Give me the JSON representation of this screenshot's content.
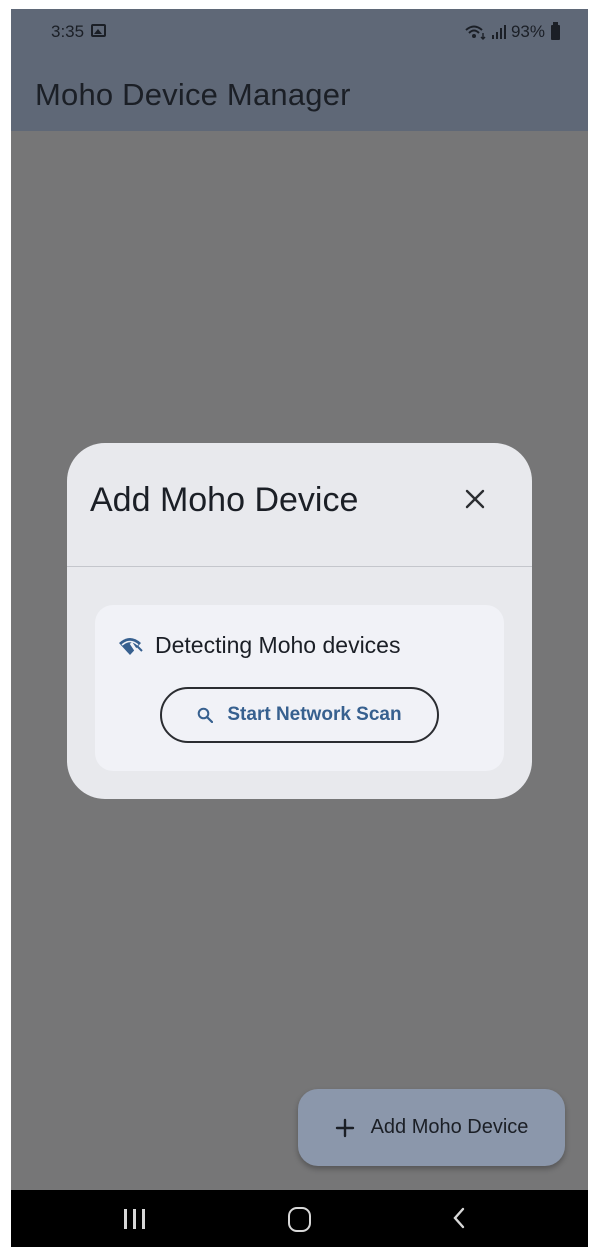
{
  "status_bar": {
    "time": "3:35",
    "battery": "93%"
  },
  "app_bar": {
    "title": "Moho Device Manager"
  },
  "dialog": {
    "title": "Add Moho Device",
    "detecting_text": "Detecting Moho devices",
    "scan_button_label": "Start Network Scan"
  },
  "fab": {
    "label": "Add Moho Device"
  },
  "icons": {
    "status": [
      "photo-icon",
      "wifi-icon",
      "signal-icon",
      "battery-icon"
    ],
    "dialog": [
      "close-icon",
      "wifi-search-icon",
      "search-icon"
    ],
    "fab": "plus-icon",
    "nav": [
      "recents-icon",
      "home-icon",
      "back-icon"
    ]
  },
  "colors": {
    "app_bar": "#5f6877",
    "scrim": "#767677",
    "dialog_surface": "#e8e9ed",
    "card_surface": "#f1f2f7",
    "accent": "#37608f",
    "fab": "#8b97ab"
  }
}
